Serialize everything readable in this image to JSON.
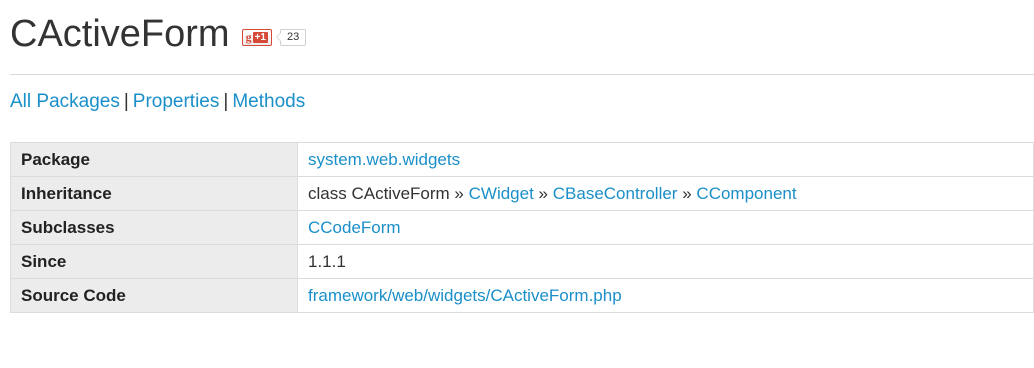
{
  "page": {
    "title": "CActiveForm"
  },
  "gplus": {
    "g_label": "g",
    "plus_label": "+1",
    "count": "23"
  },
  "nav": {
    "all_packages": "All Packages",
    "properties": "Properties",
    "methods": "Methods",
    "separator": "|"
  },
  "summary": {
    "package": {
      "label": "Package",
      "value": "system.web.widgets"
    },
    "inheritance": {
      "label": "Inheritance",
      "prefix": "class CActiveForm",
      "arrow": "»",
      "links": [
        "CWidget",
        "CBaseController",
        "CComponent"
      ]
    },
    "subclasses": {
      "label": "Subclasses",
      "value": "CCodeForm"
    },
    "since": {
      "label": "Since",
      "value": "1.1.1"
    },
    "source_code": {
      "label": "Source Code",
      "value": "framework/web/widgets/CActiveForm.php"
    }
  },
  "colors": {
    "link": "#1a8fc9",
    "text": "#333333",
    "header_cell_bg": "#ececec",
    "border": "#dcdcdc",
    "gplus_red": "#d64937"
  }
}
